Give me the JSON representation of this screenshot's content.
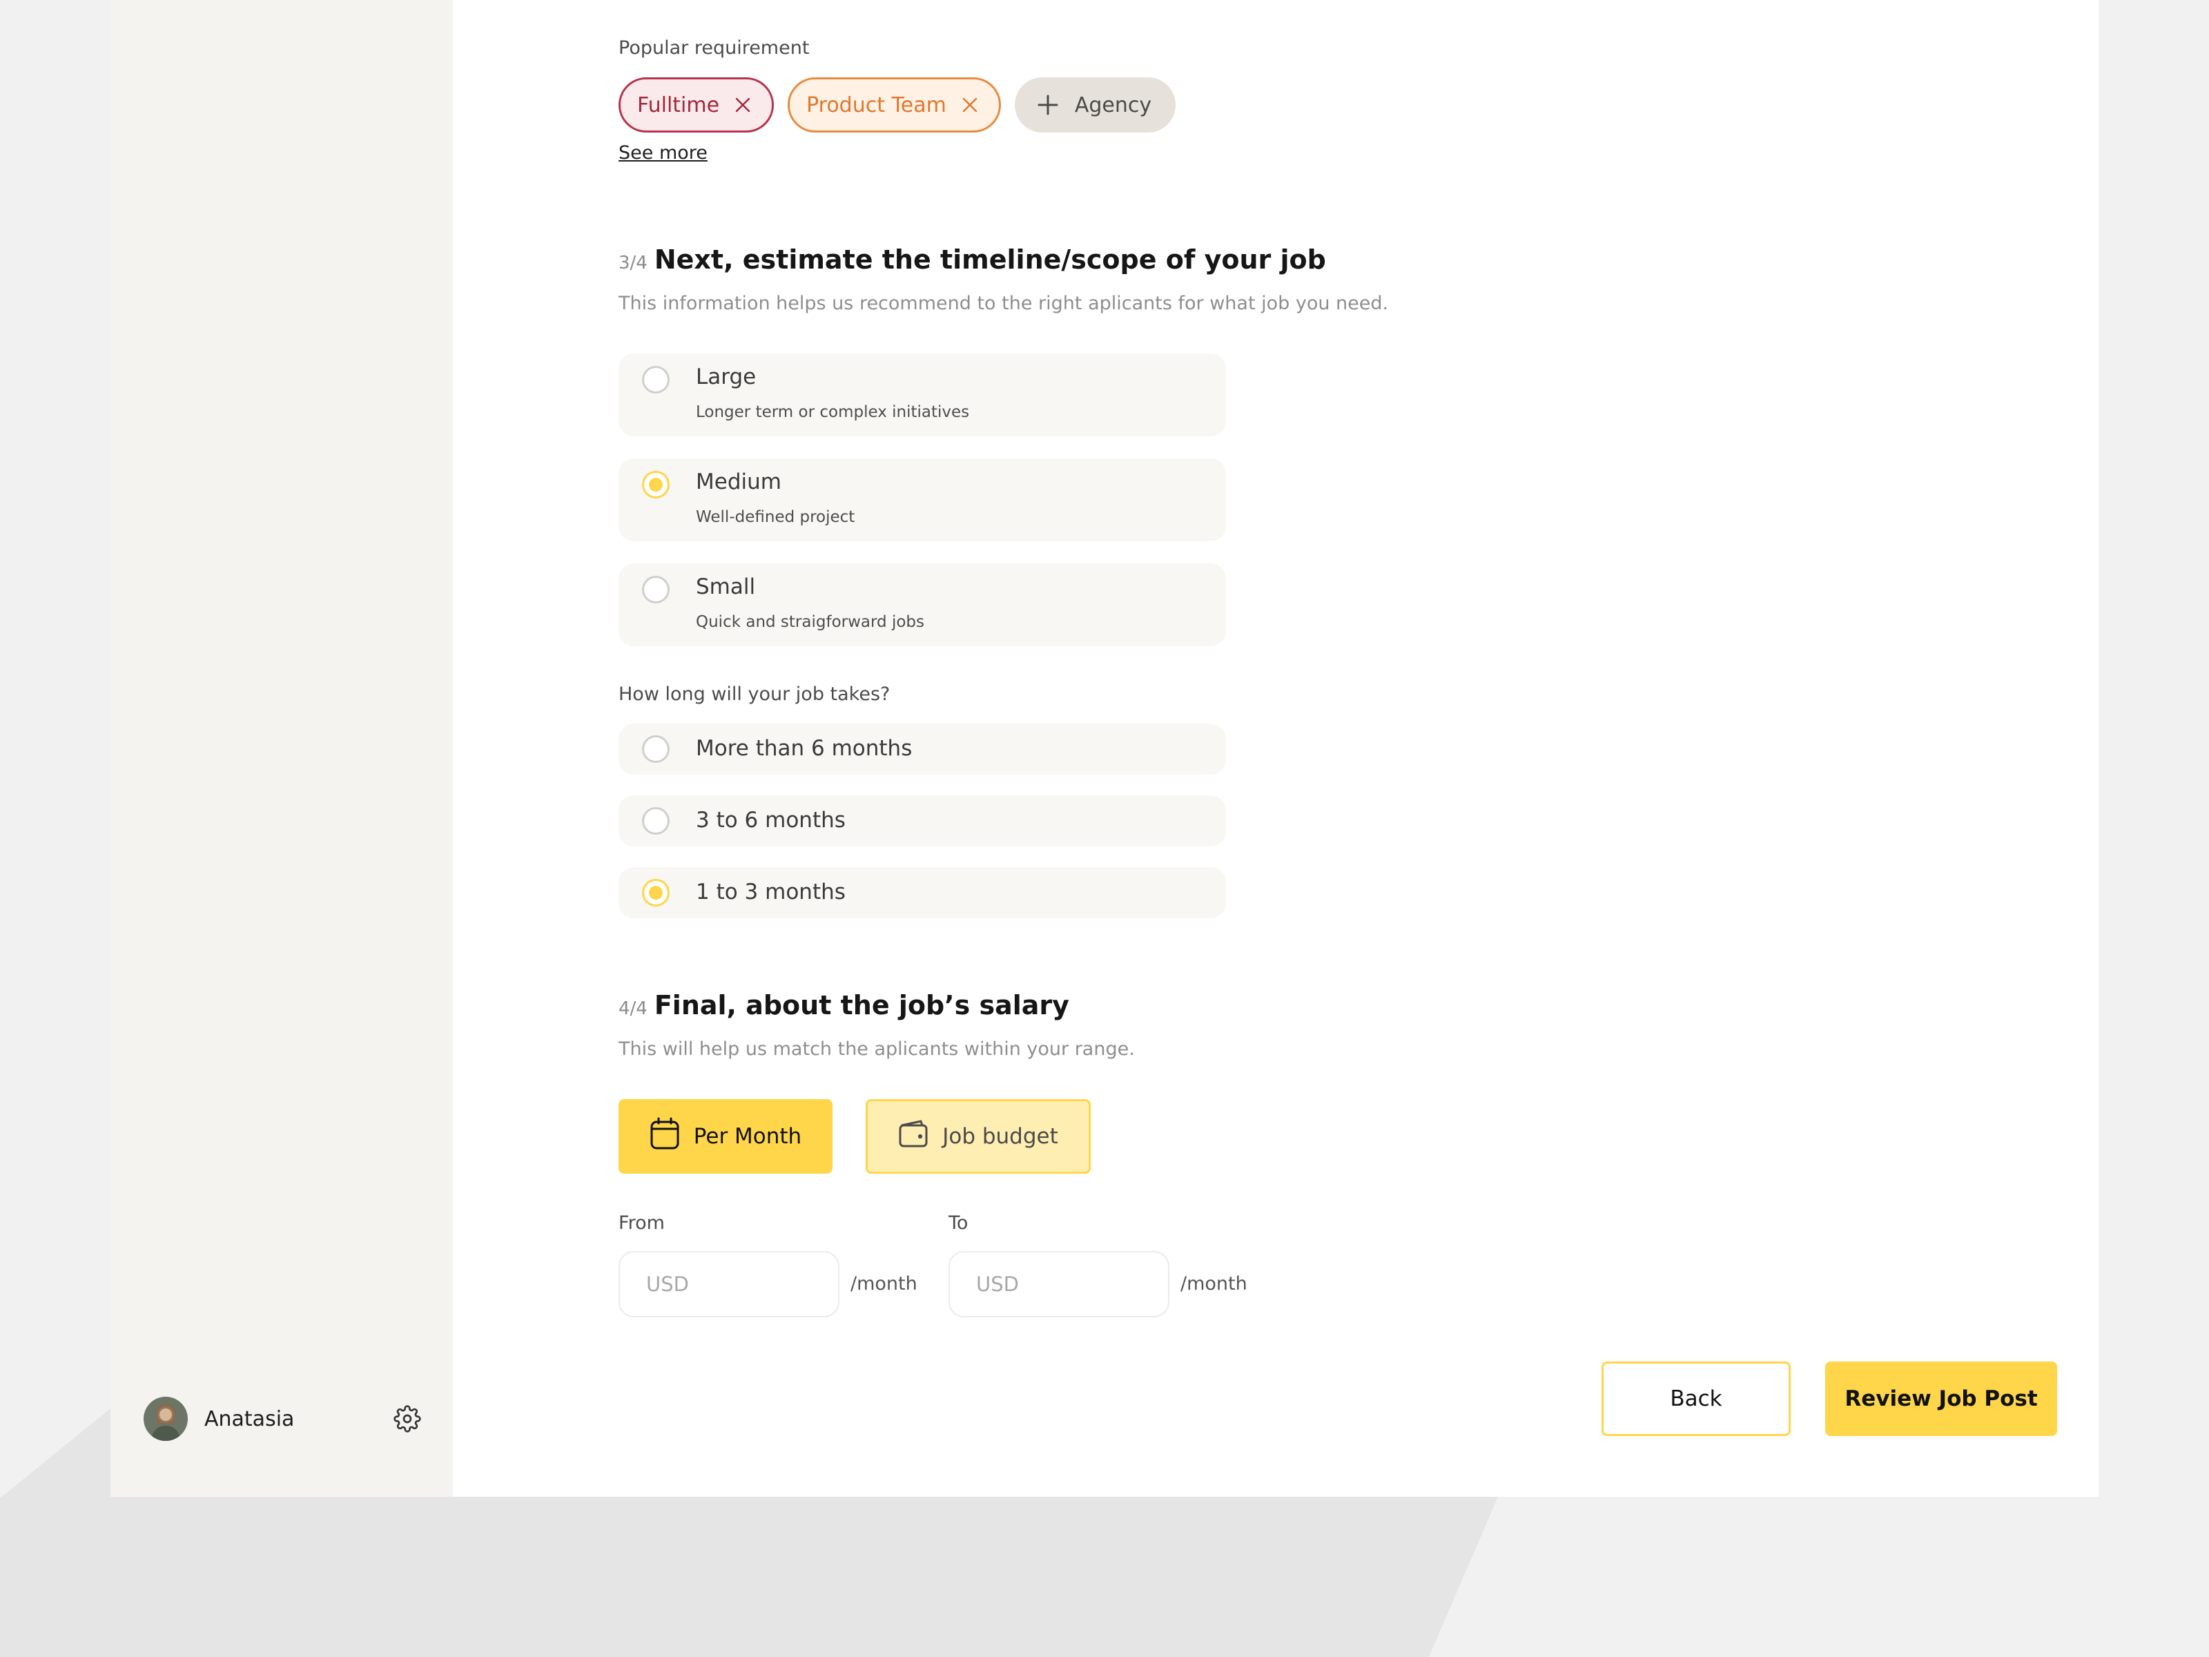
{
  "requirements": {
    "label": "Popular requirement",
    "chips": [
      {
        "label": "Fulltime",
        "color": "#b8334a",
        "selected": true
      },
      {
        "label": "Product Team",
        "color": "#e88a3f",
        "selected": true
      },
      {
        "label": "Agency",
        "color": "#e6e1da",
        "selected": false
      }
    ],
    "see_more": "See more"
  },
  "scope_section": {
    "step": "3/4",
    "title": "Next, estimate the timeline/scope of your job",
    "subtitle": "This information helps us recommend to the right aplicants for what job you need.",
    "options": [
      {
        "title": "Large",
        "desc": "Longer term or complex initiatives",
        "selected": false
      },
      {
        "title": "Medium",
        "desc": "Well-defined project",
        "selected": true
      },
      {
        "title": "Small",
        "desc": "Quick and straigforward jobs",
        "selected": false
      }
    ],
    "duration_label": "How long will your job takes?",
    "durations": [
      {
        "label": "More than 6 months",
        "selected": false
      },
      {
        "label": "3 to 6 months",
        "selected": false
      },
      {
        "label": "1 to 3 months",
        "selected": true
      }
    ]
  },
  "salary_section": {
    "step": "4/4",
    "title": "Final, about the job’s salary",
    "subtitle": "This will help us match the aplicants within your range.",
    "per_month": "Per Month",
    "job_budget": "Job budget",
    "from_label": "From",
    "to_label": "To",
    "from_placeholder": "USD",
    "to_placeholder": "USD",
    "unit": "/month"
  },
  "user": {
    "name": "Anatasia"
  },
  "actions": {
    "back": "Back",
    "review": "Review Job Post"
  },
  "colors": {
    "accent": "#ffd54a",
    "accent_light": "#ffeeb2"
  }
}
